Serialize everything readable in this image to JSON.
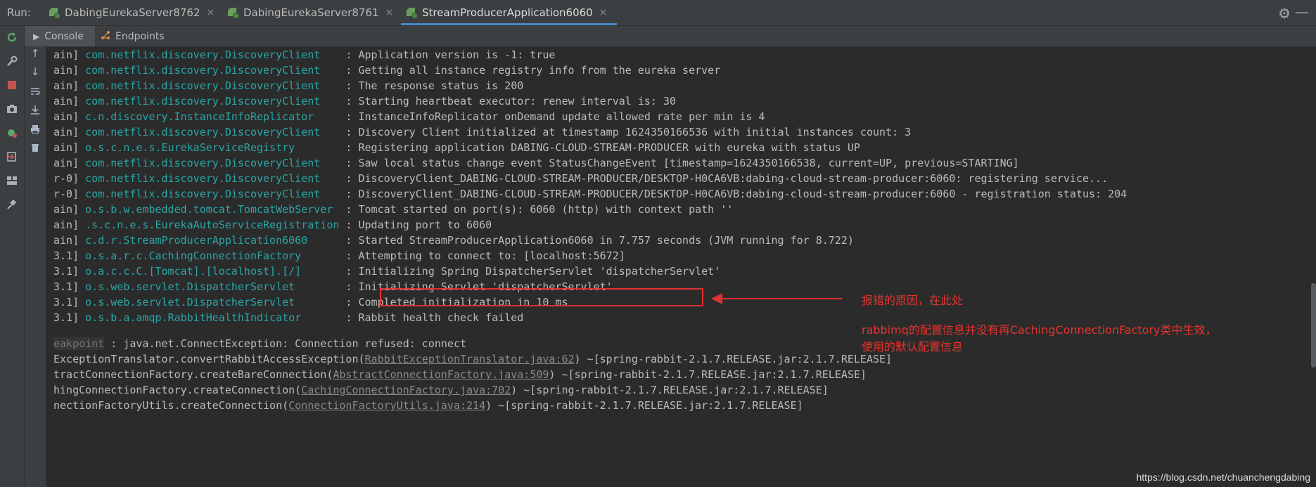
{
  "runbar": {
    "label": "Run:",
    "tabs": [
      {
        "label": "DabingEurekaServer8762",
        "close": "×"
      },
      {
        "label": "DabingEurekaServer8761",
        "close": "×"
      },
      {
        "label": "StreamProducerApplication6060",
        "close": "×"
      }
    ],
    "gear": "⚙",
    "minimize": "—"
  },
  "subtabs": {
    "console": "Console",
    "endpoints": "Endpoints"
  },
  "log_lines": [
    {
      "thread": "ain]",
      "logger": "com.netflix.discovery.DiscoveryClient   ",
      "msg": " : Application version is -1: true"
    },
    {
      "thread": "ain]",
      "logger": "com.netflix.discovery.DiscoveryClient   ",
      "msg": " : Getting all instance registry info from the eureka server"
    },
    {
      "thread": "ain]",
      "logger": "com.netflix.discovery.DiscoveryClient   ",
      "msg": " : The response status is 200"
    },
    {
      "thread": "ain]",
      "logger": "com.netflix.discovery.DiscoveryClient   ",
      "msg": " : Starting heartbeat executor: renew interval is: 30"
    },
    {
      "thread": "ain]",
      "logger": "c.n.discovery.InstanceInfoReplicator    ",
      "msg": " : InstanceInfoReplicator onDemand update allowed rate per min is 4"
    },
    {
      "thread": "ain]",
      "logger": "com.netflix.discovery.DiscoveryClient   ",
      "msg": " : Discovery Client initialized at timestamp 1624350166536 with initial instances count: 3"
    },
    {
      "thread": "ain]",
      "logger": "o.s.c.n.e.s.EurekaServiceRegistry       ",
      "msg": " : Registering application DABING-CLOUD-STREAM-PRODUCER with eureka with status UP"
    },
    {
      "thread": "ain]",
      "logger": "com.netflix.discovery.DiscoveryClient   ",
      "msg": " : Saw local status change event StatusChangeEvent [timestamp=1624350166538, current=UP, previous=STARTING]"
    },
    {
      "thread": "r-0]",
      "logger": "com.netflix.discovery.DiscoveryClient   ",
      "msg": " : DiscoveryClient_DABING-CLOUD-STREAM-PRODUCER/DESKTOP-H0CA6VB:dabing-cloud-stream-producer:6060: registering service..."
    },
    {
      "thread": "r-0]",
      "logger": "com.netflix.discovery.DiscoveryClient   ",
      "msg": " : DiscoveryClient_DABING-CLOUD-STREAM-PRODUCER/DESKTOP-H0CA6VB:dabing-cloud-stream-producer:6060 - registration status: 204"
    },
    {
      "thread": "ain]",
      "logger": "o.s.b.w.embedded.tomcat.TomcatWebServer ",
      "msg": " : Tomcat started on port(s): 6060 (http) with context path ''"
    },
    {
      "thread": "ain]",
      "logger": ".s.c.n.e.s.EurekaAutoServiceRegistration",
      "msg": " : Updating port to 6060"
    },
    {
      "thread": "ain]",
      "logger": "c.d.r.StreamProducerApplication6060     ",
      "msg": " : Started StreamProducerApplication6060 in 7.757 seconds (JVM running for 8.722)"
    },
    {
      "thread": "3.1]",
      "logger": "o.s.a.r.c.CachingConnectionFactory      ",
      "msg": " : Attempting to connect to: [localhost:5672]"
    },
    {
      "thread": "3.1]",
      "logger": "o.a.c.c.C.[Tomcat].[localhost].[/]      ",
      "msg": " : Initializing Spring DispatcherServlet 'dispatcherServlet'"
    },
    {
      "thread": "3.1]",
      "logger": "o.s.web.servlet.DispatcherServlet       ",
      "msg": " : Initializing Servlet 'dispatcherServlet'"
    },
    {
      "thread": "3.1]",
      "logger": "o.s.web.servlet.DispatcherServlet       ",
      "msg": " : Completed initialization in 10 ms"
    },
    {
      "thread": "3.1]",
      "logger": "o.s.b.a.amqp.RabbitHealthIndicator      ",
      "msg": " : Rabbit health check failed"
    }
  ],
  "stack": {
    "breakpoint": "eakpoint",
    "exception": " : java.net.ConnectException: Connection refused: connect",
    "lines": [
      {
        "pre": "ExceptionTranslator.convertRabbitAccessException(",
        "link": "RabbitExceptionTranslator.java:62",
        "post": ") ~[spring-rabbit-2.1.7.RELEASE.jar:2.1.7.RELEASE]"
      },
      {
        "pre": "tractConnectionFactory.createBareConnection(",
        "link": "AbstractConnectionFactory.java:509",
        "post": ") ~[spring-rabbit-2.1.7.RELEASE.jar:2.1.7.RELEASE]"
      },
      {
        "pre": "hingConnectionFactory.createConnection(",
        "link": "CachingConnectionFactory.java:702",
        "post": ") ~[spring-rabbit-2.1.7.RELEASE.jar:2.1.7.RELEASE]"
      },
      {
        "pre": "nectionFactoryUtils.createConnection(",
        "link": "ConnectionFactoryUtils.java:214",
        "post": ") ~[spring-rabbit-2.1.7.RELEASE.jar:2.1.7.RELEASE]"
      }
    ]
  },
  "annotations": {
    "reason": "报错的原因，在此处",
    "detail_line1": "rabbimq的配置信息并没有再CachingConnectionFactory类中生效，",
    "detail_line2": "使用的默认配置信息"
  },
  "watermark": "https://blog.csdn.net/chuanchengdabing",
  "colors": {
    "logger": "#2aa5a5",
    "annotation": "#e03030",
    "active_tab": "#4a88c7"
  }
}
